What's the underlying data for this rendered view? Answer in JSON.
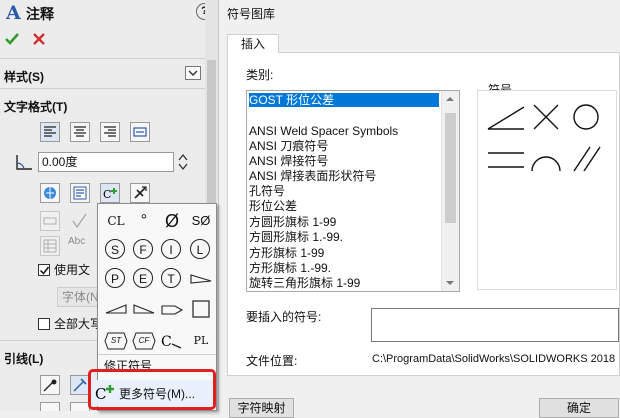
{
  "left_panel": {
    "title": "注释",
    "help_icon": "?",
    "section_style": "样式(S)",
    "section_text_format": "文字格式(T)",
    "angle_value": "0.00度",
    "checkbox_use_doc_font": "使用文",
    "font_button": "字体(N",
    "checkbox_all_caps": "全部大写",
    "section_leader": "引线(L)"
  },
  "dialog": {
    "title": "符号图库",
    "tab_insert": "插入",
    "category_label": "类别:",
    "symbol_label": "符号",
    "categories": [
      "GOST 形位公差",
      "",
      "ANSI Weld Spacer Symbols",
      "ANSI 刀痕符号",
      "ANSI 焊接符号",
      "ANSI 焊接表面形状符号",
      "孔符号",
      "形位公差",
      "方圆形旗标 1-99",
      "方圆形旗标 1.-99.",
      "方形旗标 1-99",
      "方形旗标 1.-99.",
      "旋转三角形旗标 1-99"
    ],
    "selected_category": "GOST 形位公差",
    "insert_symbol_label": "要插入的符号:",
    "file_location_label": "文件位置:",
    "file_location_value": "C:\\ProgramData\\SolidWorks\\SOLIDWORKS 2018",
    "char_map_button": "字符映射",
    "ok_button": "确定"
  },
  "popup": {
    "row1": [
      "CL",
      "°",
      "Ø",
      "SØ"
    ],
    "row2": [
      "S",
      "F",
      "I",
      "L"
    ],
    "row3": [
      "P",
      "E",
      "T",
      ""
    ],
    "row5": [
      "ST",
      "CF",
      "",
      "PL"
    ],
    "modify_symbol": "修正符号",
    "more_symbols": "更多符号(M)..."
  },
  "colors": {
    "accent": "#0078d7",
    "highlight_red": "#e02020",
    "check_green": "#2e9e2e",
    "cancel_red": "#d23030"
  }
}
